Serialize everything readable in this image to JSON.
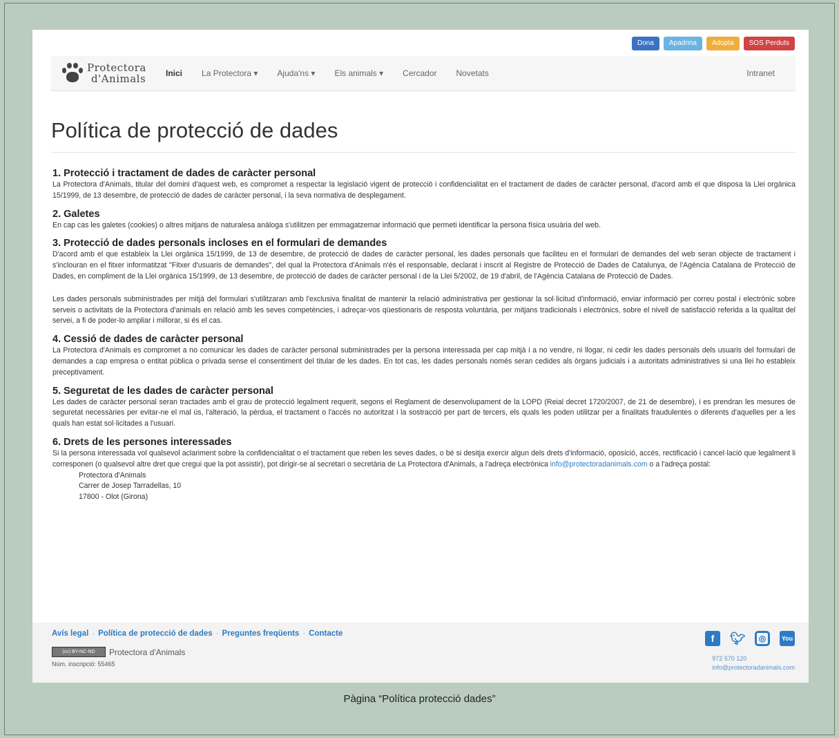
{
  "top_buttons": [
    {
      "label": "Dona",
      "color": "#3b73c2"
    },
    {
      "label": "Apadrina",
      "color": "#6ab4e2"
    },
    {
      "label": "Adopta",
      "color": "#efae3c"
    },
    {
      "label": "SOS Perduts",
      "color": "#d04444"
    }
  ],
  "logo": {
    "line1": "Protectora",
    "line2": "d'Animals"
  },
  "nav": {
    "items": [
      "Inici",
      "La Protectora ▾",
      "Ajuda'ns ▾",
      "Els animals ▾",
      "Cercador",
      "Novetats"
    ],
    "right": "Intranet"
  },
  "title": "Política de protecció de dades",
  "sections": [
    {
      "heading": "1. Protecció i tractament de dades de caràcter personal",
      "paragraphs": [
        "La Protectora d'Animals, titular del domini d'aquest web, es compromet a respectar la legislació vigent de protecció i confidencialitat en el tractament de dades de caràcter personal, d'acord amb el que disposa la Llei orgànica 15/1999, de 13 desembre, de protecció de dades de caràcter personal, i la seva normativa de desplegament."
      ]
    },
    {
      "heading": "2. Galetes",
      "paragraphs": [
        "En cap cas les galetes (cookies) o altres mitjans de naturalesa anàloga s'utilitzen per emmagatzemar informació que permeti identificar la persona física usuària del web."
      ]
    },
    {
      "heading": "3. Protecció de dades personals incloses en el formulari de demandes",
      "paragraphs": [
        "D'acord amb el que estableix la Llei orgànica 15/1999, de 13 de desembre, de protecció de dades de caràcter personal, les dades personals que faciliteu en el formulari de demandes del web seran objecte de tractament i s'inclouran en el fitxer informatitzat \"Fitxer d'usuaris de demandes\", del qual la Protectora d'Animals n'és el responsable, declarat i inscrit al Registre de Protecció de Dades de Catalunya, de l'Agència Catalana de Protecció de Dades, en compliment de la Llei orgànica 15/1999, de 13 desembre, de protecció de dades de caràcter personal i de la Llei 5/2002, de 19 d'abril, de l'Agència Catalana de Protecció de Dades.",
        "Les dades personals subministrades per mitjà del formulari s'utilitzaran amb l'exclusiva finalitat de mantenir la relació administrativa per gestionar la sol·licitud d'informació, enviar informació per correu postal i electrònic sobre serveis o activitats de la Protectora d'animals en relació amb les seves competències, i adreçar-vos qüestionaris de resposta voluntària, per mitjans tradicionals i electrònics, sobre el nivell de satisfacció referida a la qualitat del servei, a fi de poder-lo ampliar i millorar, si és el cas."
      ]
    },
    {
      "heading": "4. Cessió de dades de caràcter personal",
      "paragraphs": [
        "La Protectora d'Animals es compromet a no comunicar les dades de caràcter personal subministrades per la persona interessada per cap mitjà i a no vendre, ni llogar, ni cedir les dades personals dels usuaris del formulari de demandes a cap empresa o entitat pública o privada sense el consentiment del titular de les dades. En tot cas, les dades personals només seran cedides als òrgans judicials i a autoritats administratives si una llei ho estableix preceptivament."
      ]
    },
    {
      "heading": "5. Seguretat de les dades de caràcter personal",
      "paragraphs": [
        "Les dades de caràcter personal seran tractades amb el grau de protecció legalment requerit, segons el Reglament de desenvolupament de la LOPD (Reial decret 1720/2007, de 21 de desembre), i es prendran les mesures de seguretat necessàries per evitar-ne el mal ús, l'alteració, la pèrdua, el tractament o l'accés no autoritzat i la sostracció per part de tercers, els quals les poden utilitzar per a finalitats fraudulentes o diferents d'aquelles per a les quals han estat sol·licitades a l'usuari."
      ]
    }
  ],
  "section6": {
    "heading": "6. Drets de les persones interessades",
    "text_before": "Si la persona interessada vol qualsevol aclariment sobre la confidencialitat o el tractament que reben les seves dades, o bé si desitja exercir algun dels drets d'informació, oposició, accés, rectificació i cancel·lació que legalment li corresponen (o qualsevol altre dret que cregui que la pot assistir), pot dirigir-se al secretari o secretària de La Protectora d'Animals, a l'adreça electrònica ",
    "email": "info@protectoradanimals.com",
    "text_after": " o a l'adreça postal:",
    "address": [
      "Protectora d'Animals",
      "Carrer de Josep Tarradellas, 10",
      "17800 - Olot (Girona)"
    ]
  },
  "footer": {
    "links": [
      "Avís legal",
      "Política de protecció de dades",
      "Preguntes freqüents",
      "Contacte"
    ],
    "license_badge": "(cc) BY-NC-ND",
    "copyright": "Protectora d'Animals",
    "inscription": "Núm. inscripció: 55465",
    "social_icons": [
      "facebook-icon",
      "twitter-icon",
      "instagram-icon",
      "youtube-icon"
    ],
    "phone": "972 570 120",
    "email": "info@protectoradanimals.com"
  },
  "caption": "Pàgina “Política protecció dades”"
}
